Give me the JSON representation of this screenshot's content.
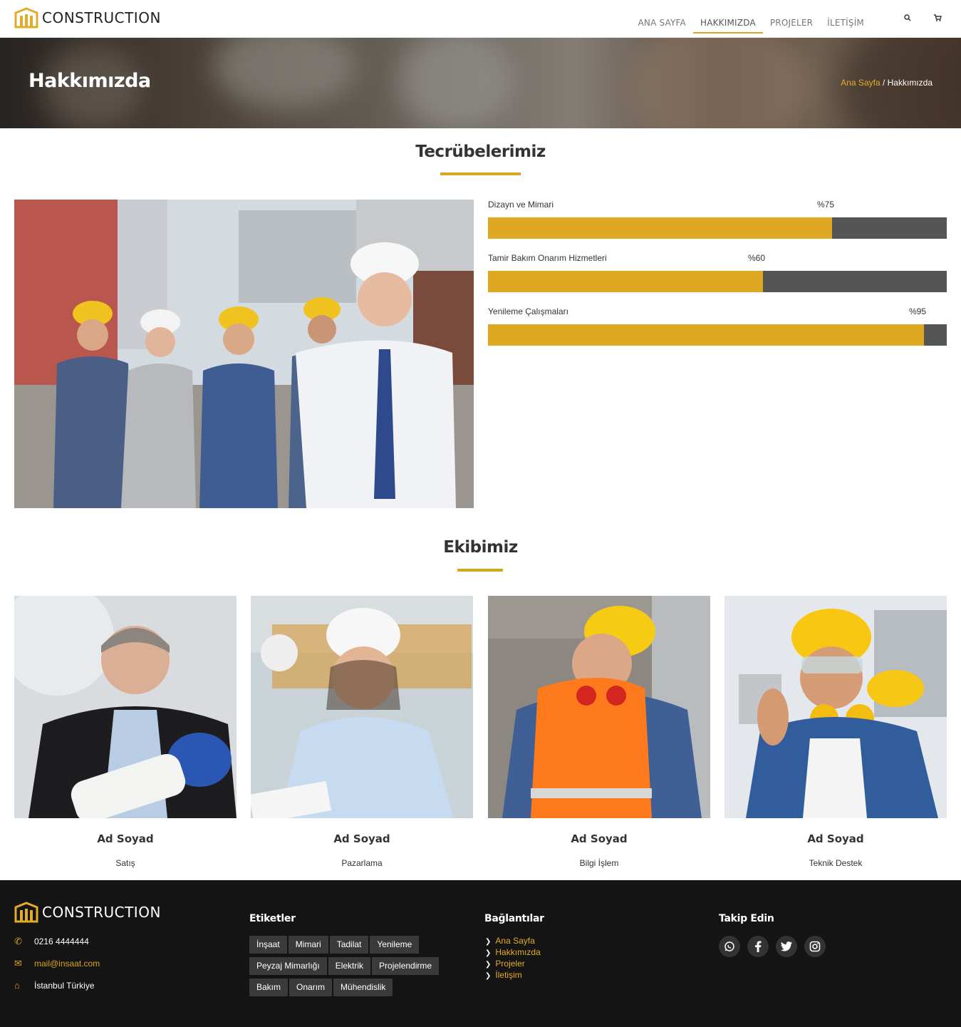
{
  "header": {
    "brand": "CONSTRUCTION",
    "nav": [
      {
        "label": "ANA SAYFA"
      },
      {
        "label": "HAKKIMIZDA"
      },
      {
        "label": "PROJELER"
      },
      {
        "label": "İLETİŞİM"
      }
    ],
    "icons": {
      "search": "search-icon",
      "cart": "cart-icon"
    },
    "accent_color": "#d9a620"
  },
  "banner": {
    "title": "Hakkımızda",
    "breadcrumb_home": "Ana Sayfa",
    "breadcrumb_sep": " / ",
    "breadcrumb_current": "Hakkımızda"
  },
  "experience": {
    "title": "Tecrübelerimiz",
    "skills": [
      {
        "label": "Dizayn ve Mimari",
        "percent_text": "%75",
        "value": 0.75
      },
      {
        "label": "Tamir Bakım Onarım Hizmetleri",
        "percent_text": "%60",
        "value": 0.6
      },
      {
        "label": "Yenileme Çalışmaları",
        "percent_text": "%95",
        "value": 0.95
      }
    ],
    "bar_color": "#dea823",
    "track_color": "#555555"
  },
  "team": {
    "title": "Ekibimiz",
    "members": [
      {
        "name": "Ad Soyad",
        "role": "Satış"
      },
      {
        "name": "Ad Soyad",
        "role": "Pazarlama"
      },
      {
        "name": "Ad Soyad",
        "role": "Bilgi İşlem"
      },
      {
        "name": "Ad Soyad",
        "role": "Teknik Destek"
      }
    ]
  },
  "footer": {
    "brand": "CONSTRUCTION",
    "phone": "0216 4444444",
    "email": "mail@insaat.com",
    "address": "İstanbul Türkiye",
    "tags_title": "Etiketler",
    "tags": [
      "İnşaat",
      "Mimari",
      "Tadilat",
      "Yenileme",
      "Peyzaj Mimarlığı",
      "Elektrik",
      "Projelendirme",
      "Bakım",
      "Onarım",
      "Mühendislik"
    ],
    "links_title": "Bağlantılar",
    "links": [
      "Ana Sayfa",
      "Hakkımızda",
      "Projeler",
      "İletişim"
    ],
    "follow_title": "Takip Edin",
    "socials": [
      "whatsapp-icon",
      "facebook-icon",
      "twitter-icon",
      "instagram-icon"
    ],
    "background": "#141414"
  }
}
